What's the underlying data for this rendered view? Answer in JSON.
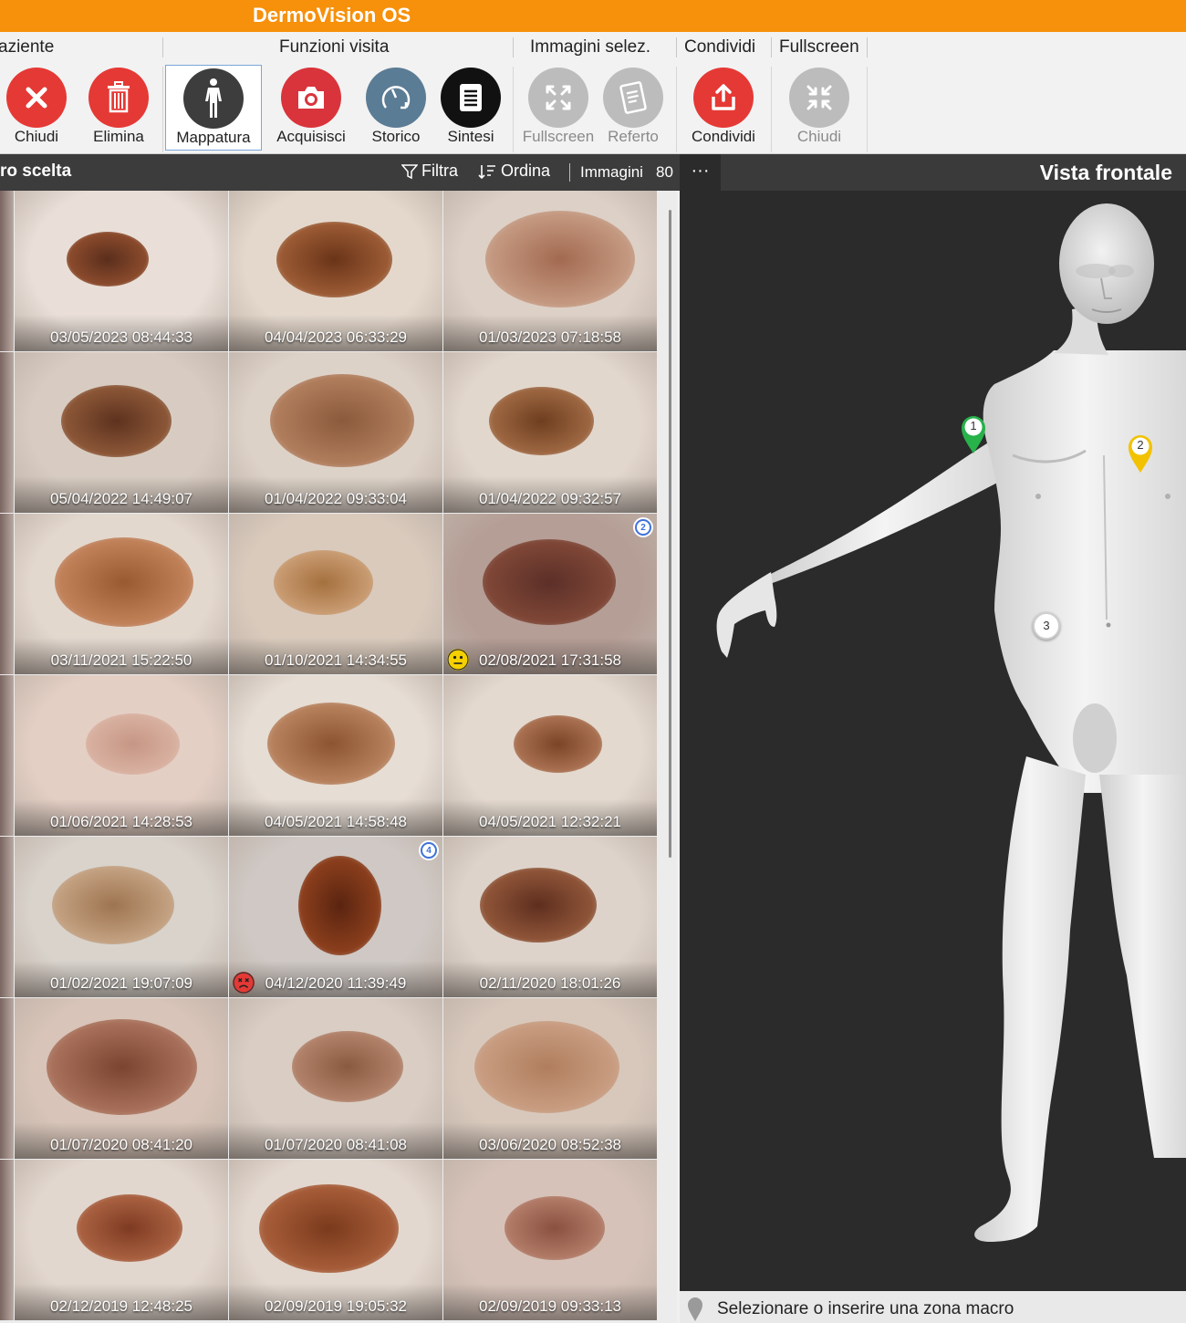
{
  "app": {
    "title": "DermoVision OS"
  },
  "ribbon": {
    "groups": [
      {
        "label": "aziente"
      },
      {
        "label": "Funzioni visita"
      },
      {
        "label": "Immagini selez."
      },
      {
        "label": "Condividi"
      },
      {
        "label": "Fullscreen"
      }
    ],
    "tools": [
      {
        "label": "Chiudi",
        "icon": "close-icon",
        "color": "#e53935"
      },
      {
        "label": "Elimina",
        "icon": "trash-icon",
        "color": "#e53935"
      },
      {
        "label": "Mappatura",
        "icon": "body-map-icon",
        "color": "#3d3d3d",
        "selected": true
      },
      {
        "label": "Acquisisci",
        "icon": "camera-icon",
        "color": "#d9343b"
      },
      {
        "label": "Storico",
        "icon": "history-icon",
        "color": "#5b7c95"
      },
      {
        "label": "Sintesi",
        "icon": "document-icon",
        "color": "#111111"
      },
      {
        "label": "Fullscreen",
        "icon": "expand-icon",
        "color": "#bcbcbc",
        "disabled": true
      },
      {
        "label": "Referto",
        "icon": "report-icon",
        "color": "#bcbcbc",
        "disabled": true
      },
      {
        "label": "Condividi",
        "icon": "share-icon",
        "color": "#e53935"
      },
      {
        "label": "Chiudi",
        "icon": "collapse-icon",
        "color": "#bcbcbc",
        "disabled": true
      }
    ]
  },
  "left_panel": {
    "title": "ro scelta",
    "filter_label": "Filtra",
    "sort_label": "Ordina",
    "images_label": "Immagini",
    "images_count": "80"
  },
  "thumbnails": [
    {
      "date": "03/05/2023 08:44:33"
    },
    {
      "date": "04/04/2023 06:33:29"
    },
    {
      "date": "01/03/2023 07:18:58"
    },
    {
      "date": "05/04/2022 14:49:07"
    },
    {
      "date": "01/04/2022 09:33:04"
    },
    {
      "date": "01/04/2022 09:32:57"
    },
    {
      "date": "03/11/2021 15:22:50"
    },
    {
      "date": "01/10/2021 14:34:55"
    },
    {
      "date": "02/08/2021 17:31:58",
      "pin": "2",
      "status": "neutral-face-icon"
    },
    {
      "date": "01/06/2021 14:28:53"
    },
    {
      "date": "04/05/2021 14:58:48"
    },
    {
      "date": "04/05/2021 12:32:21"
    },
    {
      "date": "01/02/2021 19:07:09"
    },
    {
      "date": "04/12/2020 11:39:49",
      "pin": "4",
      "status": "sad-face-icon"
    },
    {
      "date": "02/11/2020 18:01:26"
    },
    {
      "date": "01/07/2020 08:41:20"
    },
    {
      "date": "01/07/2020 08:41:08"
    },
    {
      "date": "03/06/2020 08:52:38"
    },
    {
      "date": "02/12/2019 12:48:25"
    },
    {
      "date": "02/09/2019 19:05:32"
    },
    {
      "date": "02/09/2019 09:33:13"
    }
  ],
  "right_panel": {
    "more_label": "···",
    "title": "Vista frontale",
    "markers": [
      {
        "label": "1",
        "color": "#27b24a"
      },
      {
        "label": "2",
        "color": "#f2c200"
      },
      {
        "label": "3",
        "color": "#ffffff"
      }
    ],
    "footer_text": "Selezionare o inserire una zona macro"
  }
}
